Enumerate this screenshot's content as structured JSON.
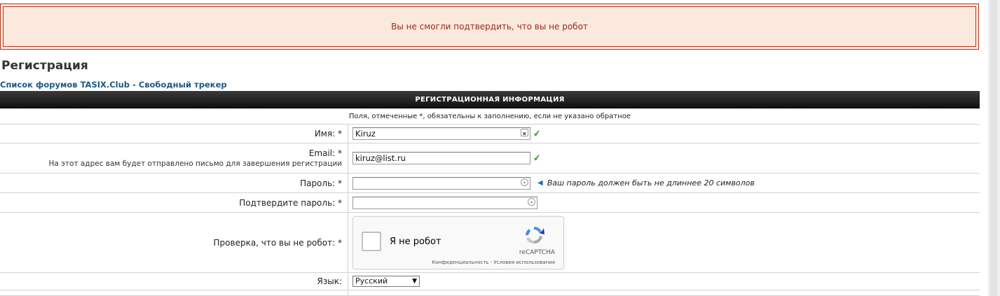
{
  "alert": {
    "message": "Вы не смогли подтвердить, что вы не робот"
  },
  "page": {
    "title": "Регистрация",
    "breadcrumb": "Список форумов TASIX.Club - Свободный трекер"
  },
  "form": {
    "header": "РЕГИСТРАЦИОННАЯ ИНФОРМАЦИЯ",
    "note": "Поля, отмеченные *, обязательны к заполнению, если не указано обратное",
    "username": {
      "label": "Имя: *",
      "value": "Kiruz"
    },
    "email": {
      "label": "Email: *",
      "sublabel": "На этот адрес вам будет отправлено письмо для завершения регистрации",
      "value": "kiruz@list.ru"
    },
    "password": {
      "label": "Пароль: *",
      "value": "",
      "hint": "Ваш пароль должен быть не длиннее 20 символов"
    },
    "confirm_password": {
      "label": "Подтвердите пароль: *",
      "value": ""
    },
    "captcha": {
      "label": "Проверка, что вы не робот: *",
      "checkbox_label": "Я не робот",
      "brand": "reCAPTCHA",
      "links": "Конфиденциальность - Условия использования"
    },
    "language": {
      "label": "Язык:",
      "selected": "Русский"
    }
  },
  "colors": {
    "alert_border": "#b0361c",
    "alert_bg": "#fbe9dd",
    "link": "#1b5a87",
    "valid_check": "#3aa530"
  },
  "icons": {
    "username_field": "contact-card-icon",
    "password_field": "key-icon",
    "valid": "checkmark-icon",
    "hint": "arrow-left-icon",
    "captcha": "recaptcha-logo-icon",
    "select": "chevron-down-icon"
  }
}
